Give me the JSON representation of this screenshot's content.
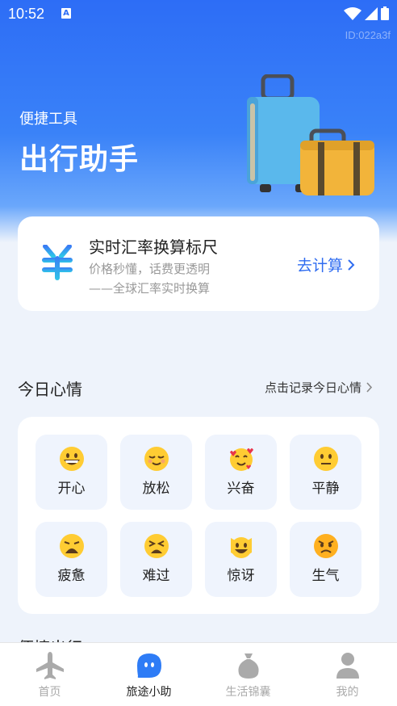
{
  "status_bar": {
    "time": "10:52",
    "notification_letter": "A"
  },
  "hero": {
    "id_label": "ID:022a3f",
    "subtitle": "便捷工具",
    "title": "出行助手"
  },
  "rate_card": {
    "title": "实时汇率换算标尺",
    "desc1": "价格秒懂，话费更透明",
    "desc2": "——全球汇率实时换算",
    "action": "去计算",
    "accent": "#2f6cf0"
  },
  "mood_section": {
    "title": "今日心情",
    "link": "点击记录今日心情",
    "items": [
      {
        "label": "开心",
        "icon": "grinning-face-icon"
      },
      {
        "label": "放松",
        "icon": "relieved-face-icon"
      },
      {
        "label": "兴奋",
        "icon": "smiling-face-with-hearts-icon"
      },
      {
        "label": "平静",
        "icon": "neutral-face-icon"
      },
      {
        "label": "疲惫",
        "icon": "weary-face-icon"
      },
      {
        "label": "难过",
        "icon": "tired-face-icon"
      },
      {
        "label": "惊讶",
        "icon": "grinning-cat-icon"
      },
      {
        "label": "生气",
        "icon": "angry-face-icon"
      }
    ]
  },
  "travel_section": {
    "title": "便捷出行"
  },
  "tabbar": {
    "tabs": [
      {
        "label": "首页",
        "icon": "airplane-icon",
        "active": false
      },
      {
        "label": "旅途小助",
        "icon": "assistant-bubble-icon",
        "active": true
      },
      {
        "label": "生活锦囊",
        "icon": "money-bag-icon",
        "active": false
      },
      {
        "label": "我的",
        "icon": "user-icon",
        "active": false
      }
    ]
  }
}
